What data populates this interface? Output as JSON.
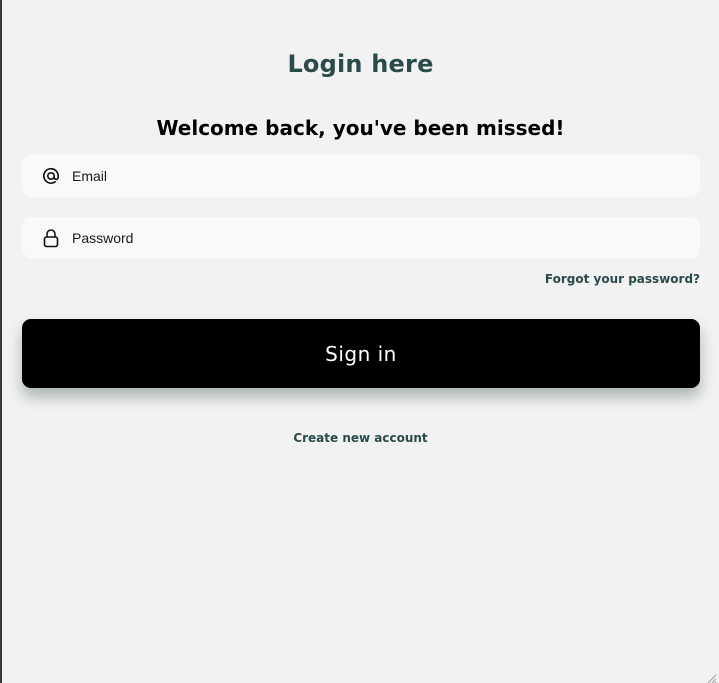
{
  "header": {
    "title": "Login here",
    "subtitle": "Welcome back, you've been missed!"
  },
  "form": {
    "email": {
      "placeholder": "Email",
      "icon": "at-sign-icon"
    },
    "password": {
      "placeholder": "Password",
      "icon": "lock-icon"
    },
    "forgot_label": "Forgot your password?",
    "signin_label": "Sign in",
    "create_label": "Create new account"
  },
  "colors": {
    "background": "#f2f2f2",
    "accent": "#2b4a4a",
    "field": "#f8f9fb",
    "button": "#000000",
    "button_text": "#ffffff"
  }
}
